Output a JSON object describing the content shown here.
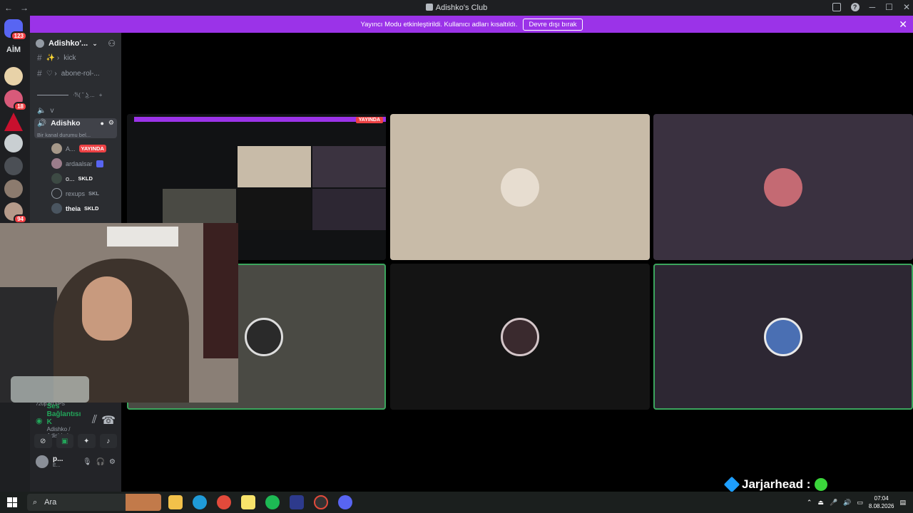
{
  "window": {
    "title": "Adishko's Club"
  },
  "guilds": {
    "home_badge": "123",
    "text_guild": "AİM",
    "badge_18": "18",
    "badge_94": "94"
  },
  "banner": {
    "message": "Yayıncı Modu etkinleştirildi. Kullanıcı adları kısaltıldı.",
    "button": "Devre dışı bırak"
  },
  "server": {
    "name": "Adishko'..."
  },
  "channels": [
    {
      "prefix": "✨ ›",
      "name": "kick"
    },
    {
      "prefix": "♡ ›",
      "name": "abone-rol-..."
    }
  ],
  "slider_row": {
    "text": "⋅𐙚( ͏˘ ͜ʖ ..."
  },
  "voice_channel_v": {
    "name": "v"
  },
  "active_voice": {
    "name": "Adishko",
    "status": "Bir kanal durumu bel..."
  },
  "members": [
    {
      "name": "A...",
      "badge": "YAYINDA"
    },
    {
      "name": "ardaalsar",
      "badge": ""
    },
    {
      "name": "o...",
      "badge": "SKLD"
    },
    {
      "name": "rexups",
      "badge": "SKL"
    },
    {
      "name": "theia",
      "badge": "SKLD"
    }
  ],
  "voice_panel": {
    "quality": "720p 60 FPS",
    "connection": "Ses Bağlantısı K",
    "location": "Adishko / Adishko'...",
    "user": "p...",
    "user_status": "E..."
  },
  "stage": {
    "live_label": "YAYINDA"
  },
  "overlay": {
    "jar_text": "Jarjarhead :"
  },
  "taskbar": {
    "search_placeholder": "Ara",
    "time": "07:04",
    "date": "8.08.2026"
  },
  "colors": {
    "accent": "#9b33e8",
    "speaking": "#3ba55d",
    "live": "#ed4245"
  }
}
